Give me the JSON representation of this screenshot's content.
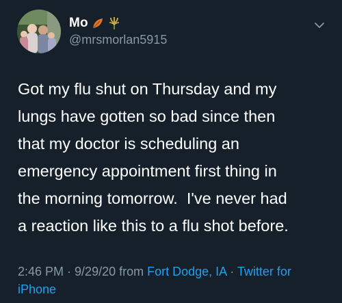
{
  "tweet": {
    "display_name": "Mo",
    "emojis": [
      "fallen-leaf-icon",
      "sheaf-of-rice-icon"
    ],
    "handle": "@mrsmorlan5915",
    "text": "Got my flu shut on Thursday and my\nlungs have gotten so bad since then\nthat my doctor is scheduling an\nemergency appointment first thing in\nthe morning tomorrow.  I've never had\na reaction like this to a flu shot before.",
    "time": "2:46 PM",
    "separator": " · ",
    "date": "9/29/20",
    "from_label": " from ",
    "location": "Fort Dodge, IA",
    "source": "Twitter for iPhone"
  },
  "colors": {
    "background": "#15202b",
    "text": "#ffffff",
    "secondary": "#8899a6",
    "link": "#1da1f2"
  },
  "icons": {
    "menu": "chevron-down-icon",
    "avatar": "avatar"
  }
}
